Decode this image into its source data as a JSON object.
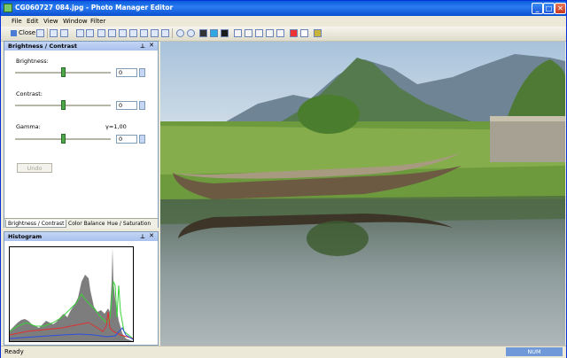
{
  "window": {
    "title": "CG060727 084.jpg - Photo Manager Editor"
  },
  "menu": [
    "File",
    "Edit",
    "View",
    "Window",
    "Filter"
  ],
  "toolbar": {
    "close_label": "Close"
  },
  "bc_panel": {
    "title": "Brightness / Contrast",
    "brightness": {
      "label": "Brightness:",
      "value": "0",
      "level": 0.5
    },
    "contrast": {
      "label": "Contrast:",
      "value": "0",
      "level": 0.5
    },
    "gamma": {
      "label": "Gamma:",
      "value": "0",
      "readout": "γ=1,00",
      "level": 0.5
    },
    "undo_label": "Undo",
    "tabs": [
      "Brightness / Contrast",
      "Color Balance",
      "Hue / Saturation"
    ]
  },
  "histogram_panel": {
    "title": "Histogram"
  },
  "statusbar": {
    "status": "Ready",
    "num": "NUM"
  },
  "colors": {
    "accent": "#0a5ddd",
    "panel_header": "#a9c1ed",
    "slider_thumb": "#4ea84a"
  },
  "icons": [
    "app-icon",
    "minimize-icon",
    "maximize-icon",
    "close-icon",
    "pin-icon",
    "panel-close-icon"
  ]
}
